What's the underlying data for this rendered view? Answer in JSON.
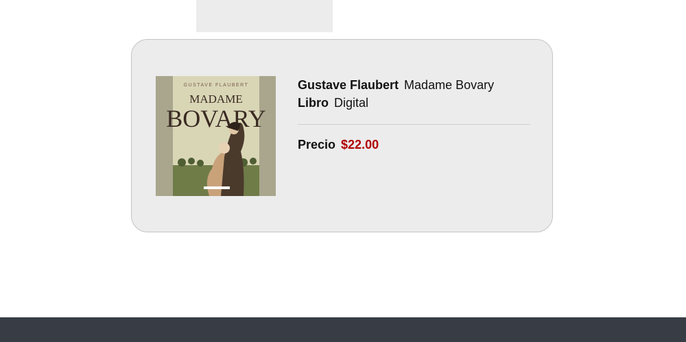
{
  "product": {
    "author": "Gustave Flaubert",
    "title": "Madame Bovary",
    "format_label": "Libro",
    "format_value": "Digital",
    "price_label": "Precio",
    "price_value": "$22.00",
    "cover": {
      "author_text": "GUSTAVE FLAUBERT",
      "title_line1": "MADAME",
      "title_line2": "BOVARY"
    }
  },
  "colors": {
    "price": "#b00000",
    "card_background": "#ececec",
    "footer": "#383c44"
  }
}
